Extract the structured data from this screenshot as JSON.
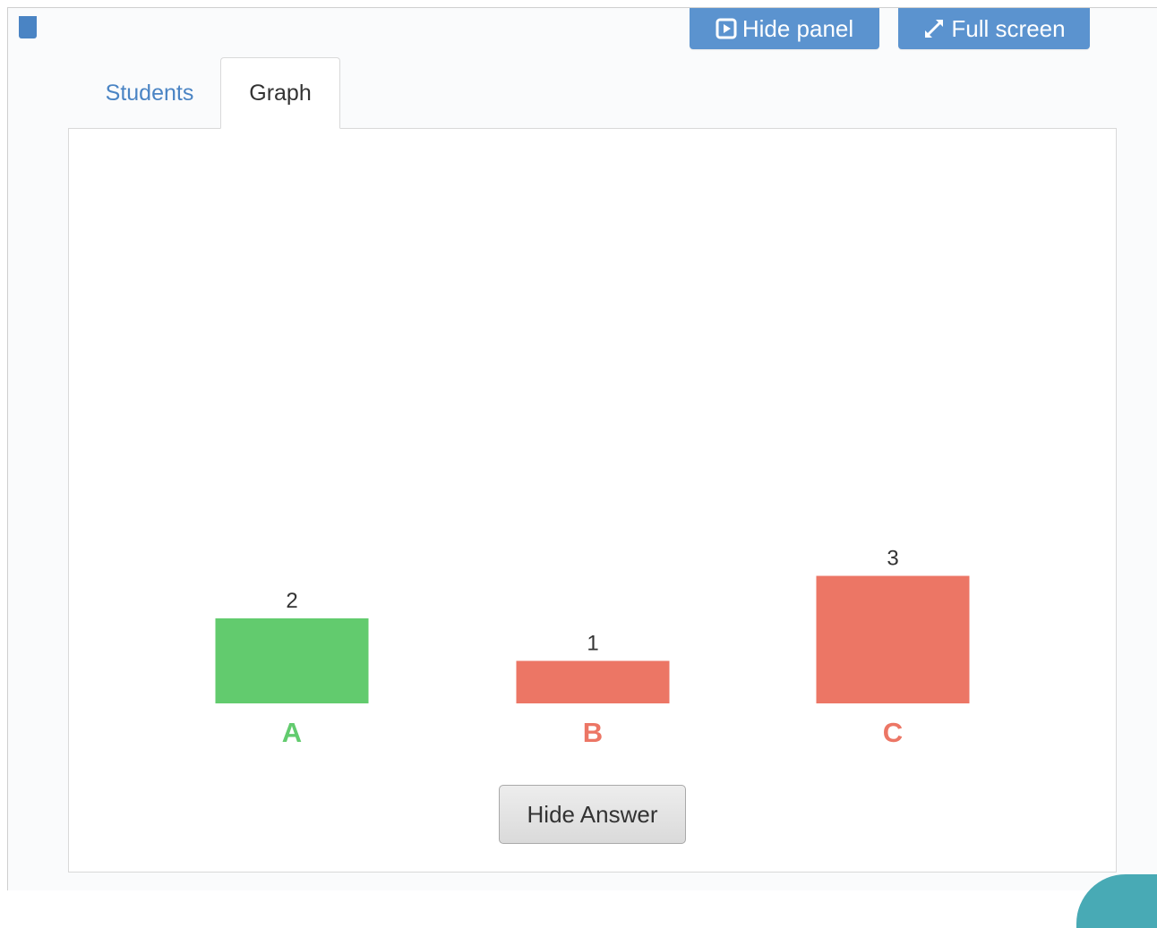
{
  "toolbar": {
    "hide_panel_label": "Hide panel",
    "full_screen_label": "Full screen",
    "hide_panel_icon": "play-square-icon",
    "full_screen_icon": "expand-arrows-icon"
  },
  "tabs": [
    {
      "label": "Students",
      "active": false
    },
    {
      "label": "Graph",
      "active": true
    }
  ],
  "colors": {
    "accent": "#5b93cf",
    "link": "#4a84c4",
    "correct": "#62cb6e",
    "incorrect": "#ec7665"
  },
  "chart_data": {
    "type": "bar",
    "categories": [
      "A",
      "B",
      "C"
    ],
    "values": [
      2,
      1,
      3
    ],
    "status": [
      "correct",
      "incorrect",
      "incorrect"
    ],
    "ylim": [
      0,
      3
    ],
    "grid": false,
    "title": "",
    "xlabel": "",
    "ylabel": ""
  },
  "graph": {
    "hide_answer_label": "Hide Answer"
  }
}
